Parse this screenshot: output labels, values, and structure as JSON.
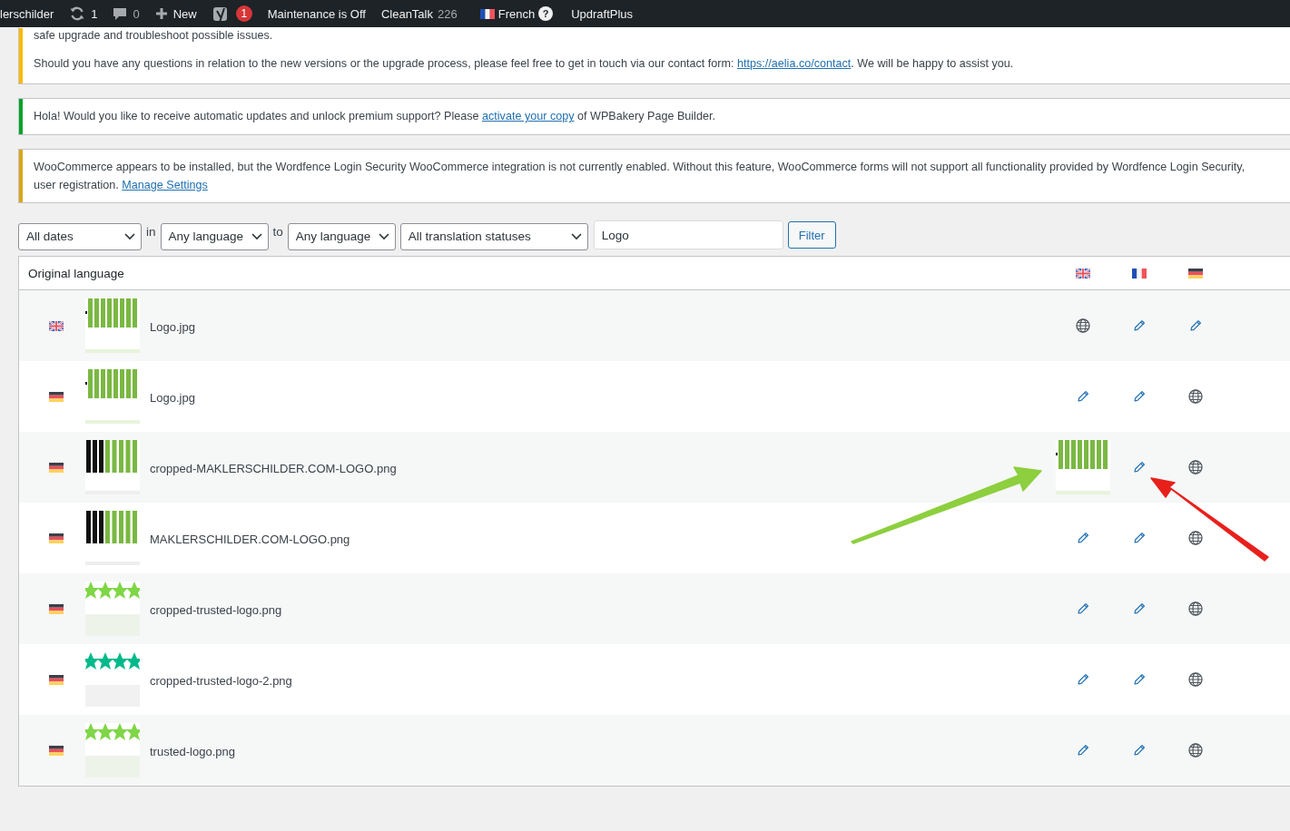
{
  "admin_bar": {
    "site": "lerschilder",
    "updates": "1",
    "comments": "0",
    "new": "New",
    "seo_badge": "1",
    "maintenance": "Maintenance is Off",
    "cleantalk": "CleanTalk",
    "cleantalk_count": "226",
    "language": "French",
    "help": "?",
    "updraft": "UpdraftPlus"
  },
  "notices": [
    {
      "color": "#ffb900",
      "lines": [
        [
          {
            "text": "safe upgrade and troubleshoot possible issues."
          }
        ],
        [
          {
            "text": "Should you have any questions in relation to the new versions or the upgrade process, please feel free to get in touch via our contact form: "
          },
          {
            "link": "https://aelia.co/contact"
          },
          {
            "text": ". We will be happy to assist you."
          }
        ]
      ]
    },
    {
      "color": "#00a32a",
      "lines": [
        [
          {
            "text": "Hola! Would you like to receive automatic updates and unlock premium support? Please "
          },
          {
            "link": "activate your copy"
          },
          {
            "text": " of WPBakery Page Builder."
          }
        ]
      ]
    },
    {
      "color": "#dba617",
      "lines": [
        [
          {
            "text": "WooCommerce appears to be installed, but the Wordfence Login Security WooCommerce integration is not currently enabled. Without this feature, WooCommerce forms will not support all functionality provided by Wordfence Login Security,"
          }
        ],
        [
          {
            "text": "user registration. "
          },
          {
            "link": "Manage Settings"
          }
        ]
      ]
    }
  ],
  "filters": [
    {
      "kind": "select",
      "value": "All dates"
    },
    {
      "kind": "label",
      "text": "in"
    },
    {
      "kind": "select",
      "value": "Any language"
    },
    {
      "kind": "label",
      "text": "to"
    },
    {
      "kind": "select",
      "value": "Any language"
    },
    {
      "kind": "select",
      "value": "All translation statuses"
    },
    {
      "kind": "input",
      "value": "Logo"
    },
    {
      "kind": "button",
      "text": "Filter"
    }
  ],
  "table": {
    "header": "Original language",
    "languages": [
      {
        "kind": "en"
      },
      {
        "kind": "fr"
      },
      {
        "kind": "de"
      }
    ],
    "rows": [
      {
        "flag": {
          "kind": "en"
        },
        "file": "Logo.jpg",
        "thumbnail": {
          "kind": "picture"
        },
        "cells": [
          {
            "kind": "globe"
          },
          {
            "kind": "pencil"
          },
          {
            "kind": "pencil"
          }
        ]
      },
      {
        "flag": {
          "kind": "de"
        },
        "file": "Logo.jpg",
        "thumbnail": {
          "kind": "picture"
        },
        "cells": [
          {
            "kind": "pencil"
          },
          {
            "kind": "pencil"
          },
          {
            "kind": "globe"
          }
        ]
      },
      {
        "flag": {
          "kind": "de"
        },
        "file": "cropped-MAKLERSCHILDER.COM-LOGO.png",
        "thumbnail": {
          "kind": "picture"
        },
        "cells": [
          {
            "kind": "picture"
          },
          {
            "kind": "pencil"
          },
          {
            "kind": "globe"
          }
        ]
      },
      {
        "flag": {
          "kind": "de"
        },
        "file": "MAKLERSCHILDER.COM-LOGO.png",
        "thumbnail": {
          "kind": "picture"
        },
        "cells": [
          {
            "kind": "pencil"
          },
          {
            "kind": "pencil"
          },
          {
            "kind": "globe"
          }
        ]
      },
      {
        "flag": {
          "kind": "de"
        },
        "file": "cropped-trusted-logo.png",
        "thumbnail": {
          "kind": "picture"
        },
        "cells": [
          {
            "kind": "pencil"
          },
          {
            "kind": "pencil"
          },
          {
            "kind": "globe"
          }
        ]
      },
      {
        "flag": {
          "kind": "de"
        },
        "file": "cropped-trusted-logo-2.png",
        "thumbnail": {
          "kind": "picture"
        },
        "cells": [
          {
            "kind": "pencil"
          },
          {
            "kind": "pencil"
          },
          {
            "kind": "globe"
          }
        ]
      },
      {
        "flag": {
          "kind": "de"
        },
        "file": "trusted-logo.png",
        "thumbnail": {
          "kind": "picture"
        },
        "cells": [
          {
            "kind": "pencil"
          },
          {
            "kind": "pencil"
          },
          {
            "kind": "globe"
          }
        ]
      }
    ]
  },
  "annotations": [
    {
      "color": "#8dcf3f"
    },
    {
      "color": "#e8201c"
    }
  ]
}
